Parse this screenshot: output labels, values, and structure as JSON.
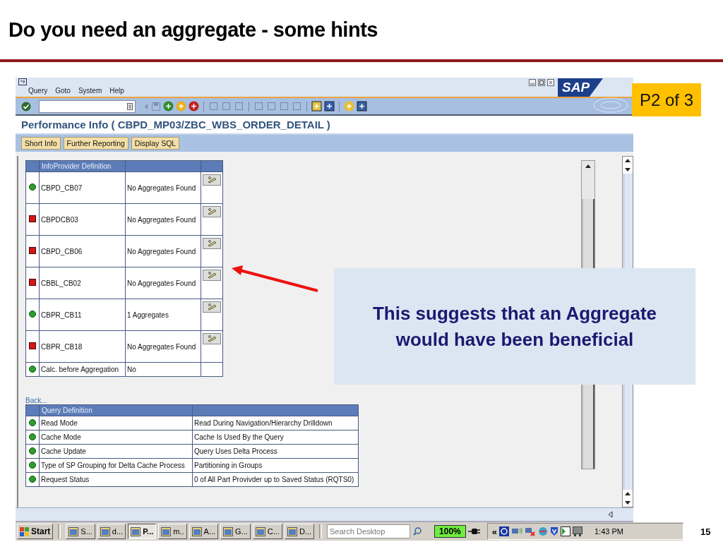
{
  "slide": {
    "title": "Do you need an aggregate - some hints",
    "badge": "P2 of 3",
    "callout": "This suggests that an Aggregate would have been beneficial",
    "page_number": "15"
  },
  "sap": {
    "logo": "SAP",
    "menu": [
      "Query",
      "Goto",
      "System",
      "Help"
    ],
    "screen_title": "Performance Info ( CBPD_MP03/ZBC_WBS_ORDER_DETAIL )",
    "buttons": [
      "Short Info",
      "Further Reporting",
      "Display SQL"
    ],
    "infoprovider_table": {
      "header": "InfoProvider Definition",
      "rows": [
        {
          "ok": true,
          "name": "CBPD_CB07",
          "value": "No Aggregates Found",
          "action": true
        },
        {
          "ok": false,
          "name": "CBPDCB03",
          "value": "No Aggregates Found",
          "action": true
        },
        {
          "ok": false,
          "name": "CBPD_CB06",
          "value": "No Aggregates Found",
          "action": true
        },
        {
          "ok": false,
          "name": "CBBL_CB02",
          "value": "No Aggregates Found",
          "action": true
        },
        {
          "ok": true,
          "name": "CBPR_CB11",
          "value": "1 Aggregates",
          "action": true
        },
        {
          "ok": false,
          "name": "CBPR_CB18",
          "value": "No Aggregates Found",
          "action": true
        },
        {
          "ok": true,
          "name": "Calc. before Aggregation",
          "value": "No",
          "action": false
        }
      ]
    },
    "back_link": "Back...",
    "query_table": {
      "header": "Query Definition",
      "rows": [
        {
          "ok": true,
          "name": "Read Mode",
          "value": "Read During Navigation/Hierarchy Drilldown"
        },
        {
          "ok": true,
          "name": "Cache Mode",
          "value": "Cache Is Used By the Query"
        },
        {
          "ok": true,
          "name": "Cache Update",
          "value": "Query Uses Delta Process"
        },
        {
          "ok": true,
          "name": "Type of SP Grouping for Delta Cache Process",
          "value": "Partitioning in Groups"
        },
        {
          "ok": true,
          "name": "Request Status",
          "value": "0 of All Part Provivder up to Saved Status (RQTS0)"
        }
      ]
    }
  },
  "taskbar": {
    "start": "Start",
    "items": [
      {
        "label": "S...",
        "selected": false
      },
      {
        "label": "d...",
        "selected": false
      },
      {
        "label": "P...",
        "selected": true
      },
      {
        "label": "m..",
        "selected": false
      },
      {
        "label": "A...",
        "selected": false
      },
      {
        "label": "G...",
        "selected": false
      },
      {
        "label": "C...",
        "selected": false
      },
      {
        "label": "D...",
        "selected": false
      }
    ],
    "search": {
      "placeholder": "Search Desktop"
    },
    "battery": "100%",
    "tray_expand": "«",
    "clock": "1:43 PM"
  }
}
